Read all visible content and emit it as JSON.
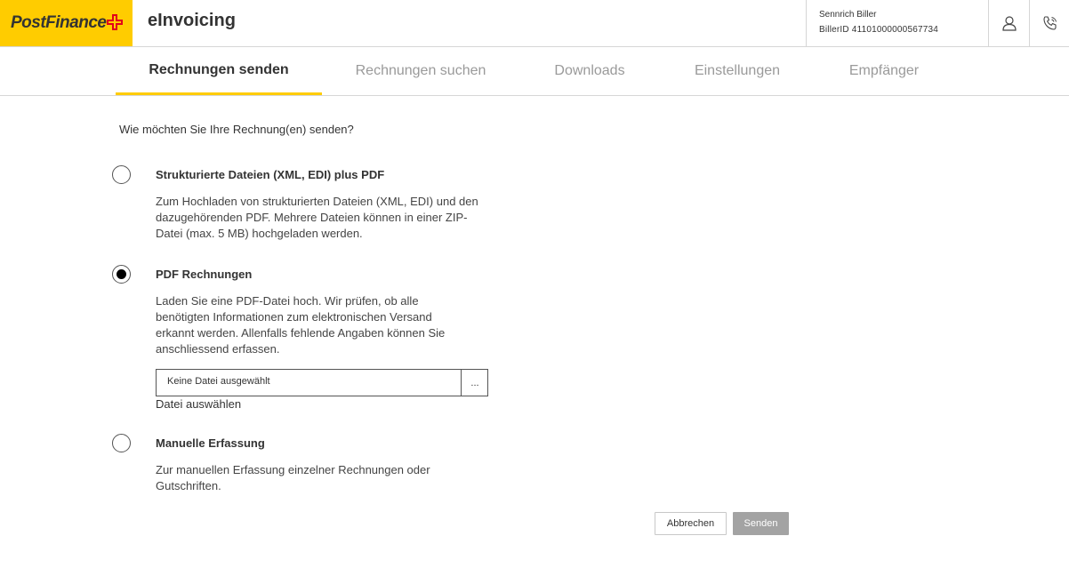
{
  "header": {
    "logo_text": "PostFinance",
    "app_title": "eInvoicing",
    "user_name": "Sennrich Biller",
    "biller_id": "BillerID 41101000000567734"
  },
  "nav": {
    "tabs": [
      {
        "label": "Rechnungen senden",
        "active": true
      },
      {
        "label": "Rechnungen suchen",
        "active": false
      },
      {
        "label": "Downloads",
        "active": false
      },
      {
        "label": "Einstellungen",
        "active": false
      },
      {
        "label": "Empfänger",
        "active": false
      }
    ]
  },
  "main": {
    "question": "Wie möchten Sie Ihre Rechnung(en) senden?",
    "options": [
      {
        "title": "Strukturierte Dateien (XML, EDI) plus PDF",
        "description": "Zum Hochladen von strukturierten Dateien (XML, EDI) und den dazugehörenden PDF. Mehrere Dateien können in einer ZIP-Datei (max. 5 MB) hochgeladen werden.",
        "selected": false
      },
      {
        "title": "PDF Rechnungen",
        "description": "Laden Sie eine PDF-Datei hoch. Wir prüfen, ob alle benötigten Informationen zum elektronischen Versand erkannt werden. Allenfalls fehlende Angaben können Sie anschliessend erfassen.",
        "selected": true
      },
      {
        "title": "Manuelle Erfassung",
        "description": "Zur manuellen Erfassung einzelner Rechnungen oder Gutschriften.",
        "selected": false
      }
    ],
    "file_input": {
      "value": "Keine Datei ausgewählt",
      "browse_label": "...",
      "label": "Datei auswählen"
    }
  },
  "actions": {
    "cancel_label": "Abbrechen",
    "send_label": "Senden"
  },
  "colors": {
    "brand_yellow": "#ffcc00",
    "brand_red": "#e2001a",
    "disabled_button": "#a3a3a3"
  }
}
